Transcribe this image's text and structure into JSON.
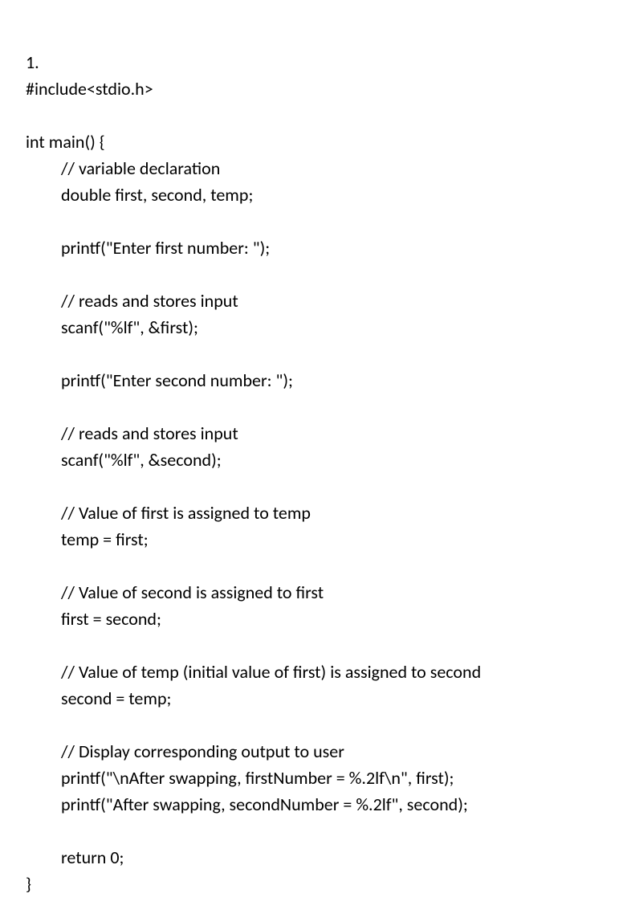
{
  "code": {
    "lines": [
      {
        "text": "1.",
        "indent": false
      },
      {
        "text": "#include<stdio.h>",
        "indent": false
      },
      {
        "text": "",
        "indent": false
      },
      {
        "text": "int main() {",
        "indent": false
      },
      {
        "text": "// variable declaration",
        "indent": true
      },
      {
        "text": "double first, second, temp;",
        "indent": true
      },
      {
        "text": "",
        "indent": false
      },
      {
        "text": "printf(\"Enter first number: \");",
        "indent": true
      },
      {
        "text": "",
        "indent": false
      },
      {
        "text": "// reads and stores input",
        "indent": true
      },
      {
        "text": "scanf(\"%lf\", &first);",
        "indent": true
      },
      {
        "text": "",
        "indent": false
      },
      {
        "text": "printf(\"Enter second number: \");",
        "indent": true
      },
      {
        "text": "",
        "indent": false
      },
      {
        "text": "// reads and stores input",
        "indent": true
      },
      {
        "text": "scanf(\"%lf\", &second);",
        "indent": true
      },
      {
        "text": "",
        "indent": false
      },
      {
        "text": "// Value of first is assigned to temp",
        "indent": true
      },
      {
        "text": "temp = first;",
        "indent": true
      },
      {
        "text": "",
        "indent": false
      },
      {
        "text": "// Value of second is assigned to first",
        "indent": true
      },
      {
        "text": "first = second;",
        "indent": true
      },
      {
        "text": "",
        "indent": false
      },
      {
        "text": "// Value of temp (initial value of first) is assigned to second",
        "indent": true
      },
      {
        "text": "second = temp;",
        "indent": true
      },
      {
        "text": "",
        "indent": false
      },
      {
        "text": "// Display corresponding output to user",
        "indent": true
      },
      {
        "text": "printf(\"\\nAfter swapping, firstNumber = %.2lf\\n\", first);",
        "indent": true
      },
      {
        "text": "printf(\"After swapping, secondNumber = %.2lf\", second);",
        "indent": true
      },
      {
        "text": "",
        "indent": false
      },
      {
        "text": "return 0;",
        "indent": true
      },
      {
        "text": "}",
        "indent": false
      }
    ]
  }
}
